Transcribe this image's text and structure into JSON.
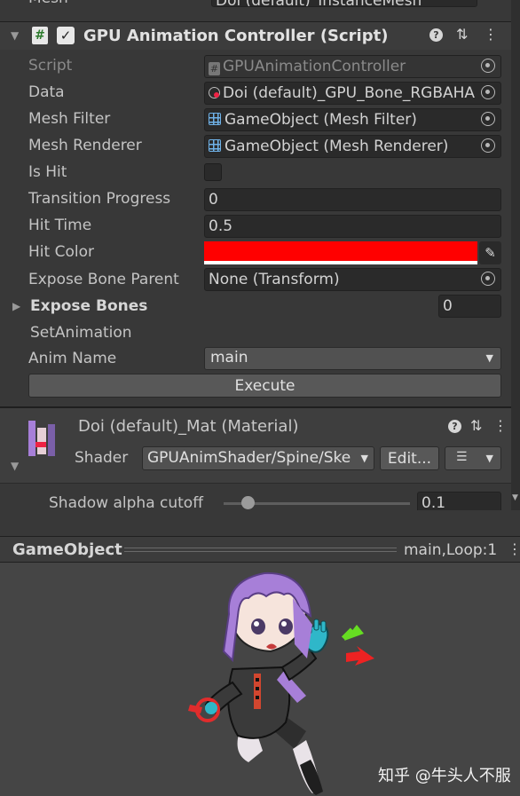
{
  "top_row": {
    "label": "Mesh",
    "value": "Doi (default)_InstanceMesh"
  },
  "component": {
    "title": "GPU Animation Controller (Script)",
    "fields": {
      "script_label": "Script",
      "script_value": "GPUAnimationController",
      "data_label": "Data",
      "data_value": "Doi (default)_GPU_Bone_RGBAHA",
      "mesh_filter_label": "Mesh Filter",
      "mesh_filter_value": "GameObject (Mesh Filter)",
      "mesh_renderer_label": "Mesh Renderer",
      "mesh_renderer_value": "GameObject (Mesh Renderer)",
      "is_hit_label": "Is Hit",
      "transition_label": "Transition Progress",
      "transition_value": "0",
      "hit_time_label": "Hit Time",
      "hit_time_value": "0.5",
      "hit_color_label": "Hit Color",
      "hit_color": "#ff0000",
      "expose_parent_label": "Expose Bone Parent",
      "expose_parent_value": "None (Transform)",
      "expose_bones_label": "Expose Bones",
      "expose_bones_count": "0",
      "set_animation_label": "SetAnimation",
      "anim_name_label": "Anim Name",
      "anim_name_value": "main",
      "execute_label": "Execute"
    }
  },
  "material": {
    "title": "Doi (default)_Mat (Material)",
    "shader_label": "Shader",
    "shader_value": "GPUAnimShader/Spine/Ske",
    "edit_label": "Edit...",
    "shadow_label": "Shadow alpha cutoff",
    "shadow_value": "0.1",
    "shadow_level": 0.1
  },
  "preview": {
    "title": "GameObject",
    "status": "main,Loop:1",
    "watermark": "知乎 @牛头人不服"
  },
  "colors": {
    "accent_red": "#ff0000",
    "green_arrow": "#66dd22",
    "red_arrow": "#ee2222",
    "hair": "#a77fd8"
  }
}
